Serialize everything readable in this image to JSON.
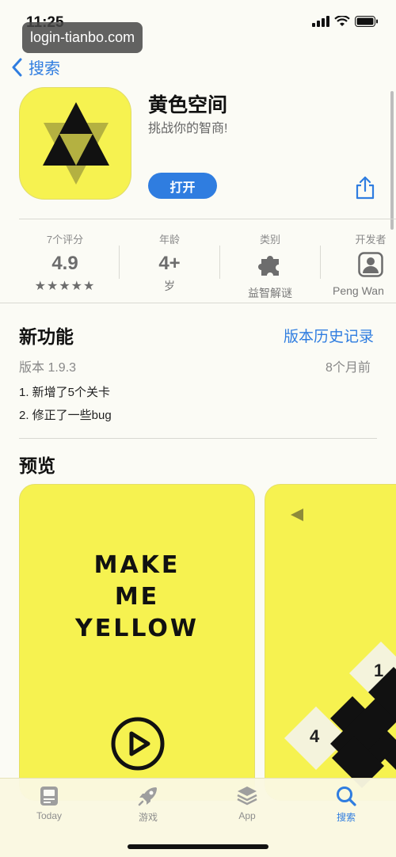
{
  "status": {
    "time": "11:25"
  },
  "overlay": {
    "url": "login-tianbo.com"
  },
  "nav": {
    "back_label": "搜索"
  },
  "app": {
    "title": "黄色空间",
    "subtitle": "挑战你的智商!",
    "open_label": "打开"
  },
  "info": [
    {
      "label": "7个评分",
      "value": "4.9",
      "extra": "★★★★★"
    },
    {
      "label": "年龄",
      "value": "4+",
      "extra": "岁"
    },
    {
      "label": "类别",
      "value": "",
      "extra": "益智解谜"
    },
    {
      "label": "开发者",
      "value": "",
      "extra": "Peng Wan"
    }
  ],
  "whats_new": {
    "heading": "新功能",
    "history_link": "版本历史记录",
    "version": "版本 1.9.3",
    "date": "8个月前",
    "notes": [
      "1. 新增了5个关卡",
      "2. 修正了一些bug"
    ]
  },
  "preview": {
    "heading": "预览",
    "make_lines": [
      "MAKE",
      "ME",
      "YELLOW"
    ],
    "tile_numbers": [
      "1",
      "4"
    ]
  },
  "tabbar": {
    "items": [
      {
        "label": "Today",
        "icon": "today-icon"
      },
      {
        "label": "游戏",
        "icon": "rocket-icon"
      },
      {
        "label": "App",
        "icon": "layers-icon"
      },
      {
        "label": "搜索",
        "icon": "search-icon"
      }
    ]
  },
  "colors": {
    "accent": "#2f7de0",
    "app_yellow": "#f6f250"
  }
}
